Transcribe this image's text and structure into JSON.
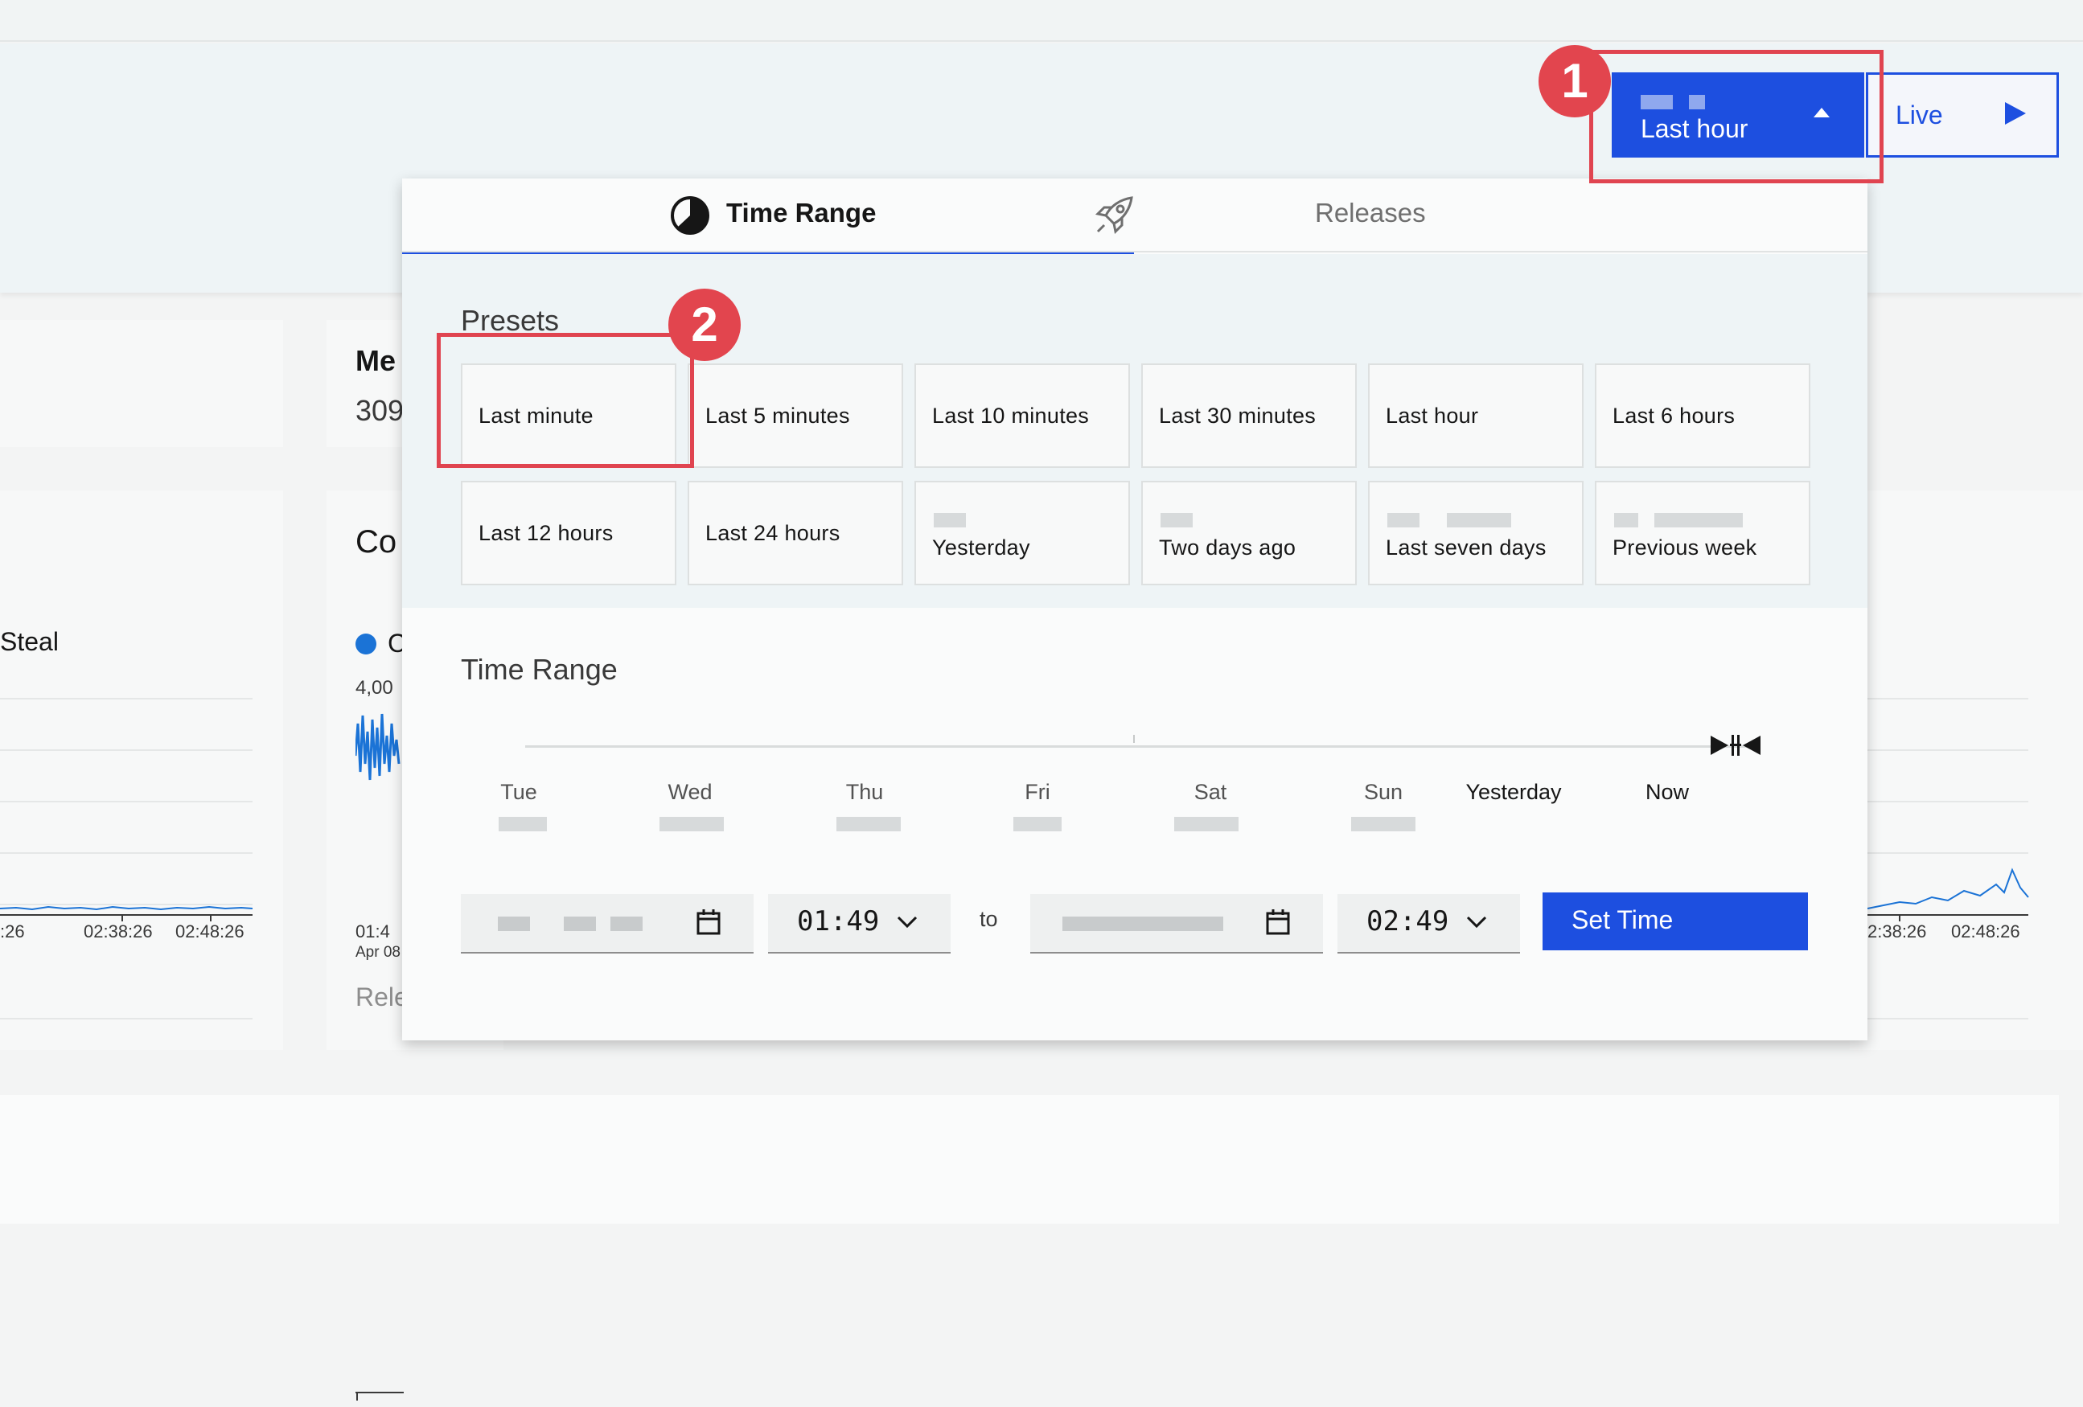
{
  "header": {
    "range_button_label": "Last hour",
    "live_button_label": "Live"
  },
  "background": {
    "card_mid_title": "Me",
    "card_mid_value": "309",
    "chart_mid_title": "Co",
    "chart_mid_legend": "C",
    "chart_mid_ytick": "4,00",
    "chart_mid_xtick_time": "01:4",
    "chart_mid_xtick_date": "Apr 08",
    "chart_mid_footer": "Rele",
    "chart_left_legend": "Steal",
    "chart_left_ticks": [
      ":26",
      "02:38:26",
      "02:48:26"
    ],
    "chart_right_ticks": [
      "2:38:26",
      "02:48:26"
    ]
  },
  "annotations": {
    "badge_1": "1",
    "badge_2": "2"
  },
  "popover": {
    "tabs": [
      {
        "label": "Time Range",
        "icon": "clock-icon",
        "selected": true
      },
      {
        "label": "Releases",
        "icon": "rocket-icon",
        "selected": false
      }
    ],
    "presets_title": "Presets",
    "presets": [
      "Last minute",
      "Last 5 minutes",
      "Last 10 minutes",
      "Last 30 minutes",
      "Last hour",
      "Last 6 hours",
      "Last 12 hours",
      "Last 24 hours",
      "Yesterday",
      "Two days ago",
      "Last seven days",
      "Previous week"
    ],
    "range_title": "Time Range",
    "days": [
      "Tue",
      "Wed",
      "Thu",
      "Fri",
      "Sat",
      "Sun",
      "Yesterday",
      "Now"
    ],
    "from_time": "01:49",
    "to_label": "to",
    "to_time": "02:49",
    "set_time_label": "Set Time"
  },
  "colors": {
    "accent": "#1d4fe0",
    "annotation": "#e2454e",
    "chart_line": "#1b73d6"
  }
}
